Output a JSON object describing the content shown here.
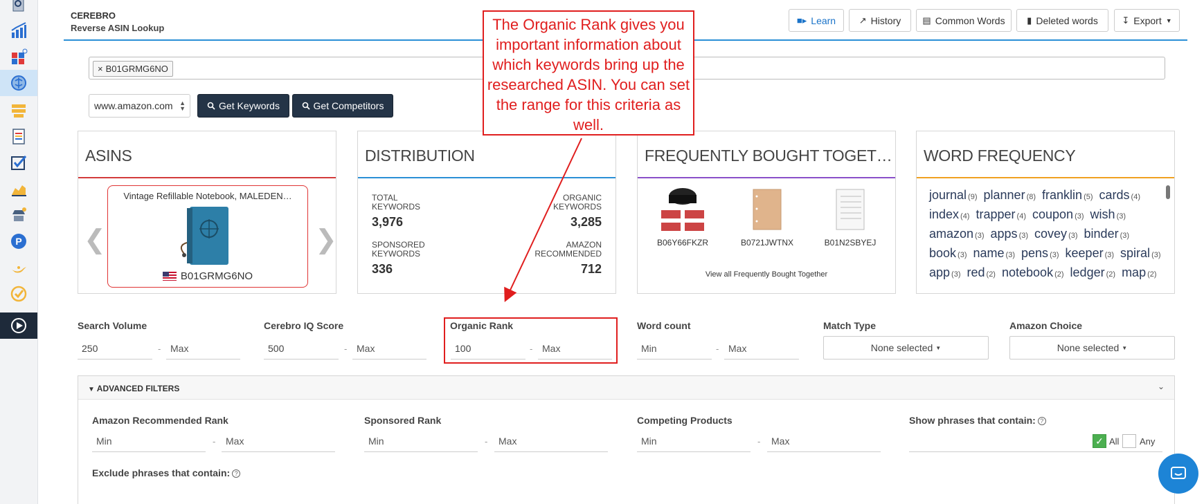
{
  "header": {
    "app_name": "CEREBRO",
    "subtitle": "Reverse ASIN Lookup",
    "buttons": {
      "learn": "Learn",
      "history": "History",
      "common_words": "Common Words",
      "deleted_words": "Deleted words",
      "export": "Export"
    }
  },
  "search": {
    "asin_tag": "B01GRMG6NO",
    "tag_remove": "×",
    "marketplace": "www.amazon.com",
    "get_keywords": "Get Keywords",
    "get_competitors": "Get Competitors"
  },
  "cards": {
    "asins": {
      "title": "ASINS",
      "product_name": "Vintage Refillable Notebook, MALEDEN…",
      "product_asin": "B01GRMG6NO"
    },
    "distribution": {
      "title": "DISTRIBUTION",
      "total_keywords_label_1": "TOTAL",
      "total_keywords_label_2": "KEYWORDS",
      "total_keywords": "3,976",
      "organic_keywords_label_1": "ORGANIC",
      "organic_keywords_label_2": "KEYWORDS",
      "organic_keywords": "3,285",
      "sponsored_keywords_label_1": "SPONSORED",
      "sponsored_keywords_label_2": "KEYWORDS",
      "sponsored_keywords": "336",
      "amazon_recommended_label_1": "AMAZON",
      "amazon_recommended_label_2": "RECOMMENDED",
      "amazon_recommended": "712"
    },
    "fbt": {
      "title": "FREQUENTLY BOUGHT TOGET…",
      "items": [
        "B06Y66FKZR",
        "B0721JWTNX",
        "B01N2SBYEJ"
      ],
      "view_all": "View all Frequently Bought Together"
    },
    "word_frequency": {
      "title": "WORD FREQUENCY",
      "words": [
        {
          "w": "journal",
          "c": "(9)"
        },
        {
          "w": "planner",
          "c": "(8)"
        },
        {
          "w": "franklin",
          "c": "(5)"
        },
        {
          "w": "cards",
          "c": "(4)"
        },
        {
          "w": "index",
          "c": "(4)"
        },
        {
          "w": "trapper",
          "c": "(4)"
        },
        {
          "w": "coupon",
          "c": "(3)"
        },
        {
          "w": "wish",
          "c": "(3)"
        },
        {
          "w": "amazon",
          "c": "(3)"
        },
        {
          "w": "apps",
          "c": "(3)"
        },
        {
          "w": "covey",
          "c": "(3)"
        },
        {
          "w": "binder",
          "c": "(3)"
        },
        {
          "w": "book",
          "c": "(3)"
        },
        {
          "w": "name",
          "c": "(3)"
        },
        {
          "w": "pens",
          "c": "(3)"
        },
        {
          "w": "keeper",
          "c": "(3)"
        },
        {
          "w": "spiral",
          "c": "(3)"
        },
        {
          "w": "app",
          "c": "(3)"
        },
        {
          "w": "red",
          "c": "(2)"
        },
        {
          "w": "notebook",
          "c": "(2)"
        },
        {
          "w": "ledger",
          "c": "(2)"
        },
        {
          "w": "map",
          "c": "(2)"
        }
      ]
    }
  },
  "filters": {
    "search_volume": {
      "label": "Search Volume",
      "min": "250",
      "max": "Max"
    },
    "iq_score": {
      "label": "Cerebro IQ Score",
      "min": "500",
      "max": "Max"
    },
    "organic_rank": {
      "label": "Organic Rank",
      "min": "100",
      "max": "Max"
    },
    "word_count": {
      "label": "Word count",
      "min": "Min",
      "max": "Max"
    },
    "match_type": {
      "label": "Match Type",
      "value": "None selected"
    },
    "amazon_choice": {
      "label": "Amazon Choice",
      "value": "None selected"
    },
    "dash": "-"
  },
  "advanced": {
    "title": "ADVANCED FILTERS",
    "amazon_rec_rank": {
      "label": "Amazon Recommended Rank",
      "min": "Min",
      "max": "Max"
    },
    "sponsored_rank": {
      "label": "Sponsored Rank",
      "min": "Min",
      "max": "Max"
    },
    "competing_products": {
      "label": "Competing Products",
      "min": "Min",
      "max": "Max"
    },
    "show_phrases": {
      "label": "Show phrases that contain:",
      "all": "All",
      "any": "Any"
    },
    "exclude_phrases": {
      "label": "Exclude phrases that contain:"
    },
    "help": "?"
  },
  "annotation": {
    "text": "The Organic Rank gives you important information about which keywords bring up the researched ASIN. You can set the range for this criteria as well."
  },
  "colors": {
    "accent_blue": "#2a8fd6",
    "dark_button": "#243447",
    "asins_line": "#d33b3b",
    "distribution_line": "#2a8fd6",
    "fbt_line": "#8a4fc9",
    "word_freq_line": "#f0a020",
    "annotation_red": "#e01e1e"
  }
}
